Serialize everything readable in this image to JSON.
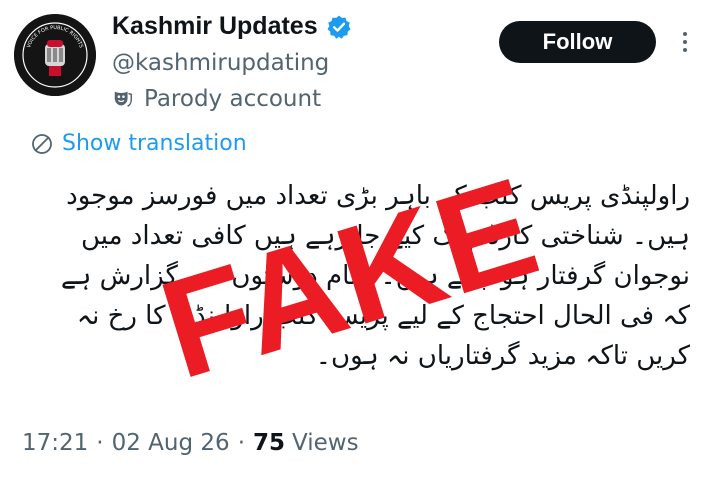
{
  "account": {
    "display_name": "Kashmir Updates",
    "handle": "@kashmirupdating",
    "label": "Parody account",
    "verified_badge_icon": "verified-badge-icon",
    "avatar_text": "VOICE FOR PUBLIC RIGHTS"
  },
  "actions": {
    "follow_label": "Follow",
    "more_icon": "more-vertical-icon"
  },
  "translation": {
    "label": "Show translation",
    "icon": "globe-icon"
  },
  "tweet": {
    "lines": [
      "راولپنڈی پریس کلب کے باہر بڑی تعداد میں فورسز موجود",
      "ہیں۔ شناختی کارڈ چیک کیے جا رہے ہیں کافی تعداد میں",
      "نوجوان گرفتار ہو چکے ہیں۔ تمام دوستوں سے گزارش ہے",
      "کہ فی الحال احتجاج کے لیے پریس کلب راولپنڈی کا رخ نہ",
      "کریں تاکہ مزید گرفتاریاں نہ ہوں۔"
    ]
  },
  "stamp": {
    "text": "FAKE",
    "color": "#ec1c24"
  },
  "meta": {
    "time": "17:21",
    "date": "02 Aug 26",
    "views_count": "75",
    "views_label": "Views",
    "separator": "·"
  },
  "colors": {
    "text_primary": "#0f1419",
    "text_secondary": "#536471",
    "link": "#1d9bf0",
    "verified": "#1d9bf0",
    "follow_bg": "#0f1419"
  }
}
